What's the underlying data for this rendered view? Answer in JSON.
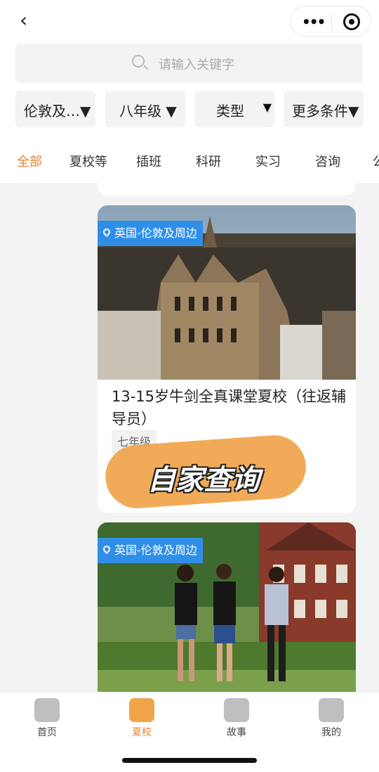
{
  "header": {
    "back_icon": "chevron-left-icon",
    "more_icon": "more-dots-icon",
    "close_icon": "target-circle-icon"
  },
  "search": {
    "placeholder": "请输入关键字"
  },
  "filters": [
    {
      "label": "伦敦及…▼"
    },
    {
      "label": "八年级 ▼"
    },
    {
      "label": "类型"
    },
    {
      "label": "更多条件▼"
    }
  ],
  "tabs": [
    "全部",
    "夏校等",
    "插班",
    "科研",
    "实习",
    "咨询",
    "公"
  ],
  "cards": [
    {
      "location": "英国-伦敦及周边",
      "title": "13-15岁牛剑全真课堂夏校（往返辅导员）",
      "grade": "七年级"
    },
    {
      "location": "英国-伦敦及周边"
    }
  ],
  "overlay": {
    "text": "自家查询",
    "color": "#f0a44a"
  },
  "bottom_nav": [
    {
      "label": "首页",
      "icon": "home-icon"
    },
    {
      "label": "夏校",
      "icon": "graduation-cap-icon"
    },
    {
      "label": "故事",
      "icon": "heart-chat-icon"
    },
    {
      "label": "我的",
      "icon": "user-icon"
    }
  ],
  "colors": {
    "accent": "#e58532",
    "location_tag": "#2f8fe8"
  }
}
